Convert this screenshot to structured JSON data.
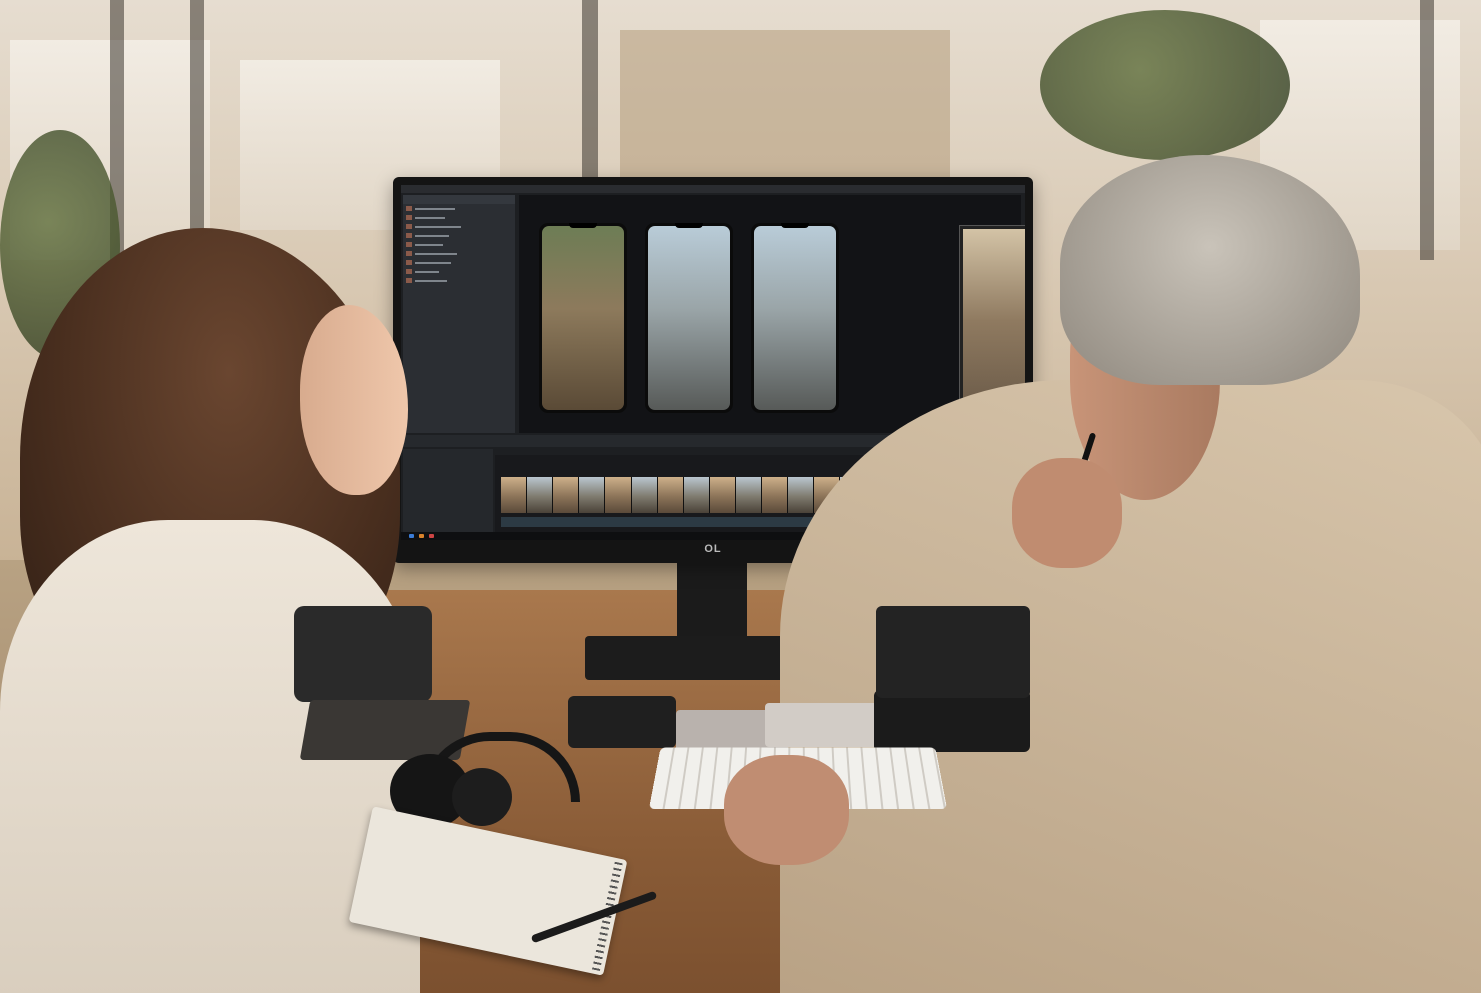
{
  "scene": {
    "kind": "photograph",
    "subjects": [
      "woman-editor",
      "man-editor"
    ],
    "colors": {
      "ui_bg": "#1d1f22",
      "desk": "#8a5c37",
      "wall": "#d8c8b2"
    }
  },
  "monitor": {
    "brand": "OL",
    "app": {
      "clip_count": 18,
      "viewer_frames": [
        {
          "kind": "phone-vertical",
          "tone": "greenery"
        },
        {
          "kind": "phone-vertical",
          "tone": "cyclist"
        },
        {
          "kind": "phone-vertical",
          "tone": "cyclist"
        },
        {
          "kind": "wide-frame",
          "tone": "warehouse"
        }
      ],
      "icons": [
        "folder-icon",
        "play-icon",
        "scissors-icon"
      ]
    }
  }
}
